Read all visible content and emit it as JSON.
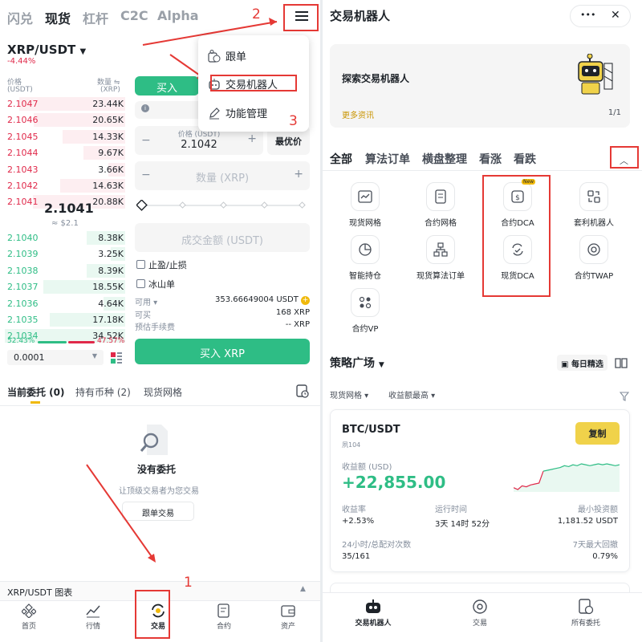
{
  "left": {
    "top_tabs": [
      "闪兑",
      "现货",
      "杠杆",
      "C2C",
      "Alpha"
    ],
    "pair": "XRP/USDT",
    "change": "-4.44%",
    "ob_header": {
      "price": "价格",
      "price_unit": "(USDT)",
      "qty": "数量",
      "qty_unit": "(XRP)"
    },
    "asks": [
      {
        "p": "2.1047",
        "q": "23.44K",
        "depth": 0.88
      },
      {
        "p": "2.1046",
        "q": "20.65K",
        "depth": 0.76
      },
      {
        "p": "2.1045",
        "q": "14.33K",
        "depth": 0.52
      },
      {
        "p": "2.1044",
        "q": "9.67K",
        "depth": 0.35
      },
      {
        "p": "2.1043",
        "q": "3.66K",
        "depth": 0.14
      },
      {
        "p": "2.1042",
        "q": "14.63K",
        "depth": 0.54
      },
      {
        "p": "2.1041",
        "q": "20.88K",
        "depth": 0.77
      }
    ],
    "mid_price": "2.1041",
    "mid_usd": "≈ $2.1",
    "bids": [
      {
        "p": "2.1040",
        "q": "8.38K",
        "depth": 0.32
      },
      {
        "p": "2.1039",
        "q": "3.25K",
        "depth": 0.12
      },
      {
        "p": "2.1038",
        "q": "8.39K",
        "depth": 0.32
      },
      {
        "p": "2.1037",
        "q": "18.55K",
        "depth": 0.68
      },
      {
        "p": "2.1036",
        "q": "4.64K",
        "depth": 0.18
      },
      {
        "p": "2.1035",
        "q": "17.18K",
        "depth": 0.63
      },
      {
        "p": "2.1034",
        "q": "34.52K",
        "depth": 1.0
      }
    ],
    "ratio_buy": "52.43%",
    "ratio_sell": "47.57%",
    "precision": "0.0001",
    "buy_tab": "买入",
    "price_label": "价格 (USDT)",
    "price_value": "2.1042",
    "best_price": "最优价",
    "qty_placeholder": "数量 (XRP)",
    "total_placeholder": "成交金额 (USDT)",
    "tpsl": "止盈/止损",
    "iceberg": "冰山单",
    "avail_label": "可用",
    "avail_value": "353.66649004 USDT",
    "buyable_label": "可买",
    "buyable_value": "168 XRP",
    "fee_label": "预估手续费",
    "fee_value": "-- XRP",
    "buy_button": "买入 XRP",
    "order_tabs": [
      "当前委托 (0)",
      "持有币种 (2)",
      "现货网格"
    ],
    "empty_title": "没有委托",
    "empty_sub": "让顶级交易者为您交易",
    "copy_trade_btn": "跟单交易",
    "chart_bar": "XRP/USDT 图表",
    "menu": [
      "跟单",
      "交易机器人",
      "功能管理"
    ],
    "annotations": [
      "1",
      "2",
      "3"
    ],
    "nav": [
      "首页",
      "行情",
      "交易",
      "合约",
      "资产"
    ]
  },
  "right": {
    "title": "交易机器人",
    "more_btn": "•••",
    "close_btn": "✕",
    "banner_title": "探索交易机器人",
    "banner_link": "更多资讯",
    "banner_page": "1/1",
    "filters": [
      "全部",
      "算法订单",
      "横盘整理",
      "看涨",
      "看跌"
    ],
    "bots": [
      "现货网格",
      "合约网格",
      "合约DCA",
      "套利机器人",
      "智能持仓",
      "现货算法订单",
      "现货DCA",
      "合约TWAP",
      "合约VP"
    ],
    "new_badge": "New",
    "plaza": "策略广场",
    "daily_pick": "每日精选",
    "sort1": "现货网格",
    "sort2": "收益额最高",
    "card": {
      "pair": "BTC/USDT",
      "user": "夙104",
      "copy_btn": "复制",
      "profit_label": "收益额 (USD)",
      "profit": "+22,855.00",
      "rate_label": "收益率",
      "rate": "+2.53%",
      "runtime_label": "运行时间",
      "runtime": "3天 14时 52分",
      "mininv_label": "最小投资额",
      "mininv": "1,181.52 USDT",
      "trades_label": "24小时/总配对次数",
      "trades": "35/161",
      "dd_label": "7天最大回撤",
      "dd": "0.79%"
    },
    "spark": [
      12,
      10,
      14,
      13,
      15,
      16,
      17,
      30,
      31,
      32,
      33,
      34,
      36,
      35,
      37,
      36,
      38,
      37,
      36,
      37,
      38,
      37,
      38,
      37,
      36,
      37
    ],
    "nav": [
      "交易机器人",
      "交易",
      "所有委托"
    ]
  },
  "colors": {
    "green": "#2ebd85",
    "red": "#e0294a",
    "yellow": "#f0d24a",
    "annot": "#e53935"
  }
}
